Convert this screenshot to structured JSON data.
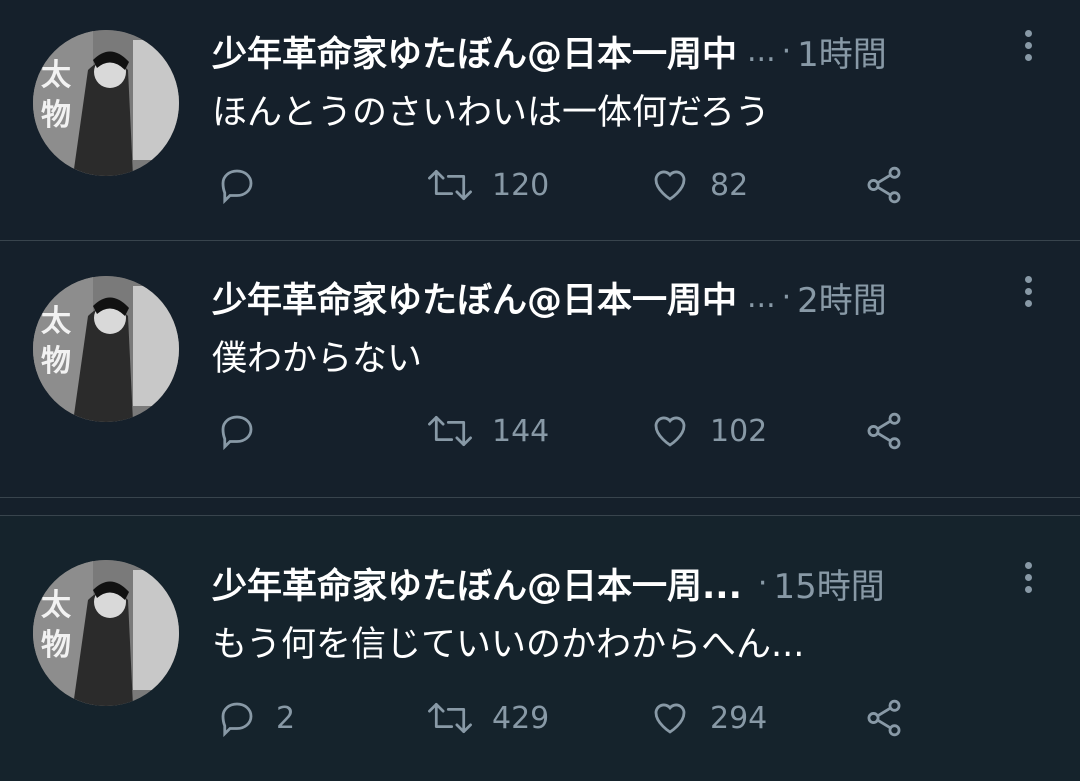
{
  "tweets": [
    {
      "author": "少年革命家ゆたぼん@日本一周中",
      "ellipsis": "...",
      "time": "1時間",
      "text": "ほんとうのさいわいは一体何だろう",
      "replies": "",
      "retweets": "120",
      "likes": "82"
    },
    {
      "author": "少年革命家ゆたぼん@日本一周中",
      "ellipsis": "...",
      "time": "2時間",
      "text": "僕わからない",
      "replies": "",
      "retweets": "144",
      "likes": "102"
    },
    {
      "author": "少年革命家ゆたぼん@日本一周...",
      "ellipsis": "",
      "time": "15時間",
      "text": "もう何を信じていいのかわからへん...",
      "replies": "2",
      "retweets": "429",
      "likes": "294"
    }
  ],
  "icons": {
    "reply": "reply-icon",
    "retweet": "retweet-icon",
    "like": "heart-icon",
    "share": "share-icon",
    "more": "more-vertical-icon"
  },
  "colors": {
    "background": "#15202b",
    "muted": "#8899a6",
    "divider": "#38444d",
    "text": "#ffffff"
  }
}
